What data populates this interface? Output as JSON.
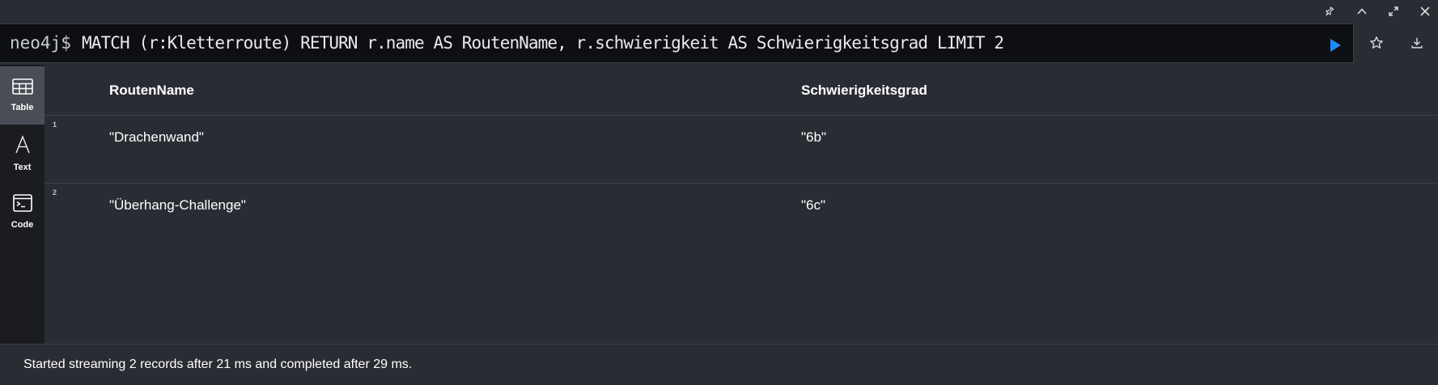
{
  "editor": {
    "prompt": "neo4j$",
    "query": "MATCH (r:Kletterroute) RETURN r.name AS RoutenName, r.schwierigkeit AS Schwierigkeitsgrad LIMIT 2"
  },
  "toolbar_icons": [
    "pin-icon",
    "collapse-icon",
    "expand-icon",
    "close-icon",
    "run-icon",
    "star-icon",
    "download-icon"
  ],
  "sidebar": {
    "items": [
      {
        "label": "Table",
        "icon": "table-icon",
        "active": true
      },
      {
        "label": "Text",
        "icon": "text-icon",
        "active": false
      },
      {
        "label": "Code",
        "icon": "code-icon",
        "active": false
      }
    ]
  },
  "table": {
    "columns": [
      "RoutenName",
      "Schwierigkeitsgrad"
    ],
    "rows": [
      {
        "index": "1",
        "cells": [
          "\"Drachenwand\"",
          "\"6b\""
        ]
      },
      {
        "index": "2",
        "cells": [
          "\"Überhang-Challenge\"",
          "\"6c\""
        ]
      }
    ]
  },
  "status": {
    "text": "Started streaming 2 records after 21 ms and completed after 29 ms."
  },
  "colors": {
    "background": "#2a2c33",
    "editor_bg": "#0e0f12",
    "sidebar_bg": "#1b1c20",
    "run_accent": "#1a8cff"
  }
}
